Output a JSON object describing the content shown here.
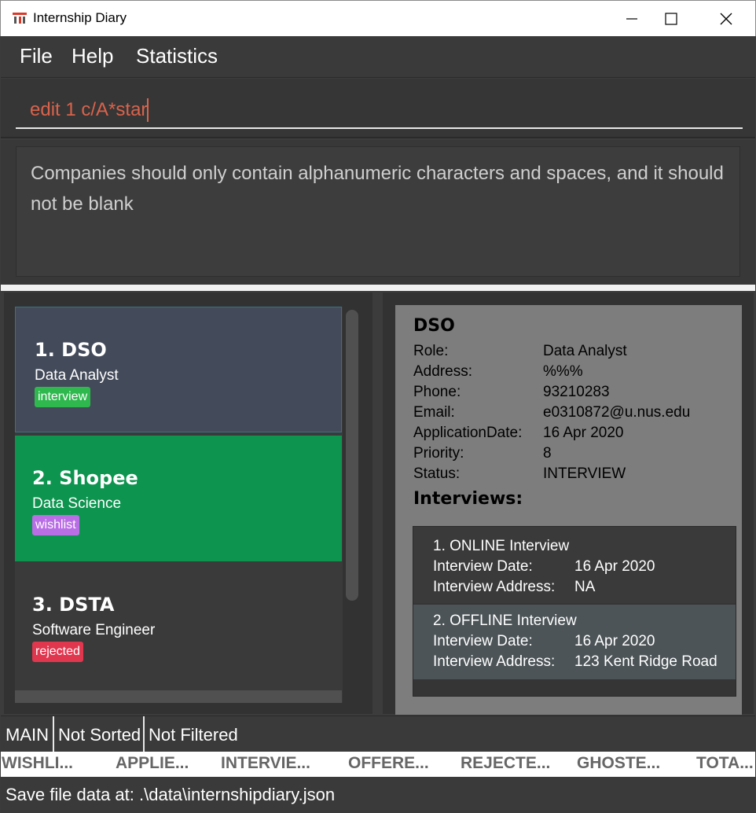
{
  "window": {
    "title": "Internship Diary",
    "icon": "app-logo-icon"
  },
  "menu": {
    "items": [
      "File",
      "Help",
      "Statistics"
    ]
  },
  "command": {
    "value": "edit 1 c/A*star"
  },
  "result": {
    "message": "Companies should only contain alphanumeric characters and spaces, and it should not be blank"
  },
  "list": {
    "items": [
      {
        "name": "1.  DSO",
        "role": "Data Analyst",
        "tag": "interview",
        "tag_color": "#2eb84e",
        "bg": "#434a5a",
        "selected": true
      },
      {
        "name": "2.  Shopee",
        "role": "Data Science",
        "tag": "wishlist",
        "tag_color": "#b96ee6",
        "bg": "#0d944f",
        "selected": false
      },
      {
        "name": "3.  DSTA",
        "role": "Software Engineer",
        "tag": "rejected",
        "tag_color": "#e0364e",
        "bg": "#3a3a3a",
        "selected": false
      }
    ]
  },
  "detail": {
    "company": "DSO",
    "fields": [
      {
        "label": "Role:",
        "value": "Data Analyst"
      },
      {
        "label": "Address:",
        "value": "%%%"
      },
      {
        "label": "Phone:",
        "value": "93210283"
      },
      {
        "label": "Email:",
        "value": "e0310872@u.nus.edu"
      },
      {
        "label": "ApplicationDate:",
        "value": "16 Apr 2020"
      },
      {
        "label": "Priority:",
        "value": "8"
      },
      {
        "label": "Status:",
        "value": "INTERVIEW"
      }
    ],
    "interviews_heading": "Interviews:",
    "interviews": [
      {
        "title": "1. ONLINE Interview",
        "date_label": "Interview Date:",
        "date": "16 Apr 2020",
        "address_label": "Interview Address:",
        "address": "NA"
      },
      {
        "title": "2. OFFLINE Interview",
        "date_label": "Interview Date:",
        "date": "16 Apr 2020",
        "address_label": "Interview Address:",
        "address": "123 Kent Ridge Road"
      }
    ]
  },
  "status": {
    "view": "MAIN",
    "sort": "Not Sorted",
    "filter": "Not Filtered"
  },
  "counts": [
    "WISHLI...",
    "APPLIE...",
    "INTERVIE...",
    "OFFERE...",
    "REJECTE...",
    "GHOSTE...",
    "TOTA..."
  ],
  "save_location": "Save file data at: .\\data\\internshipdiary.json"
}
